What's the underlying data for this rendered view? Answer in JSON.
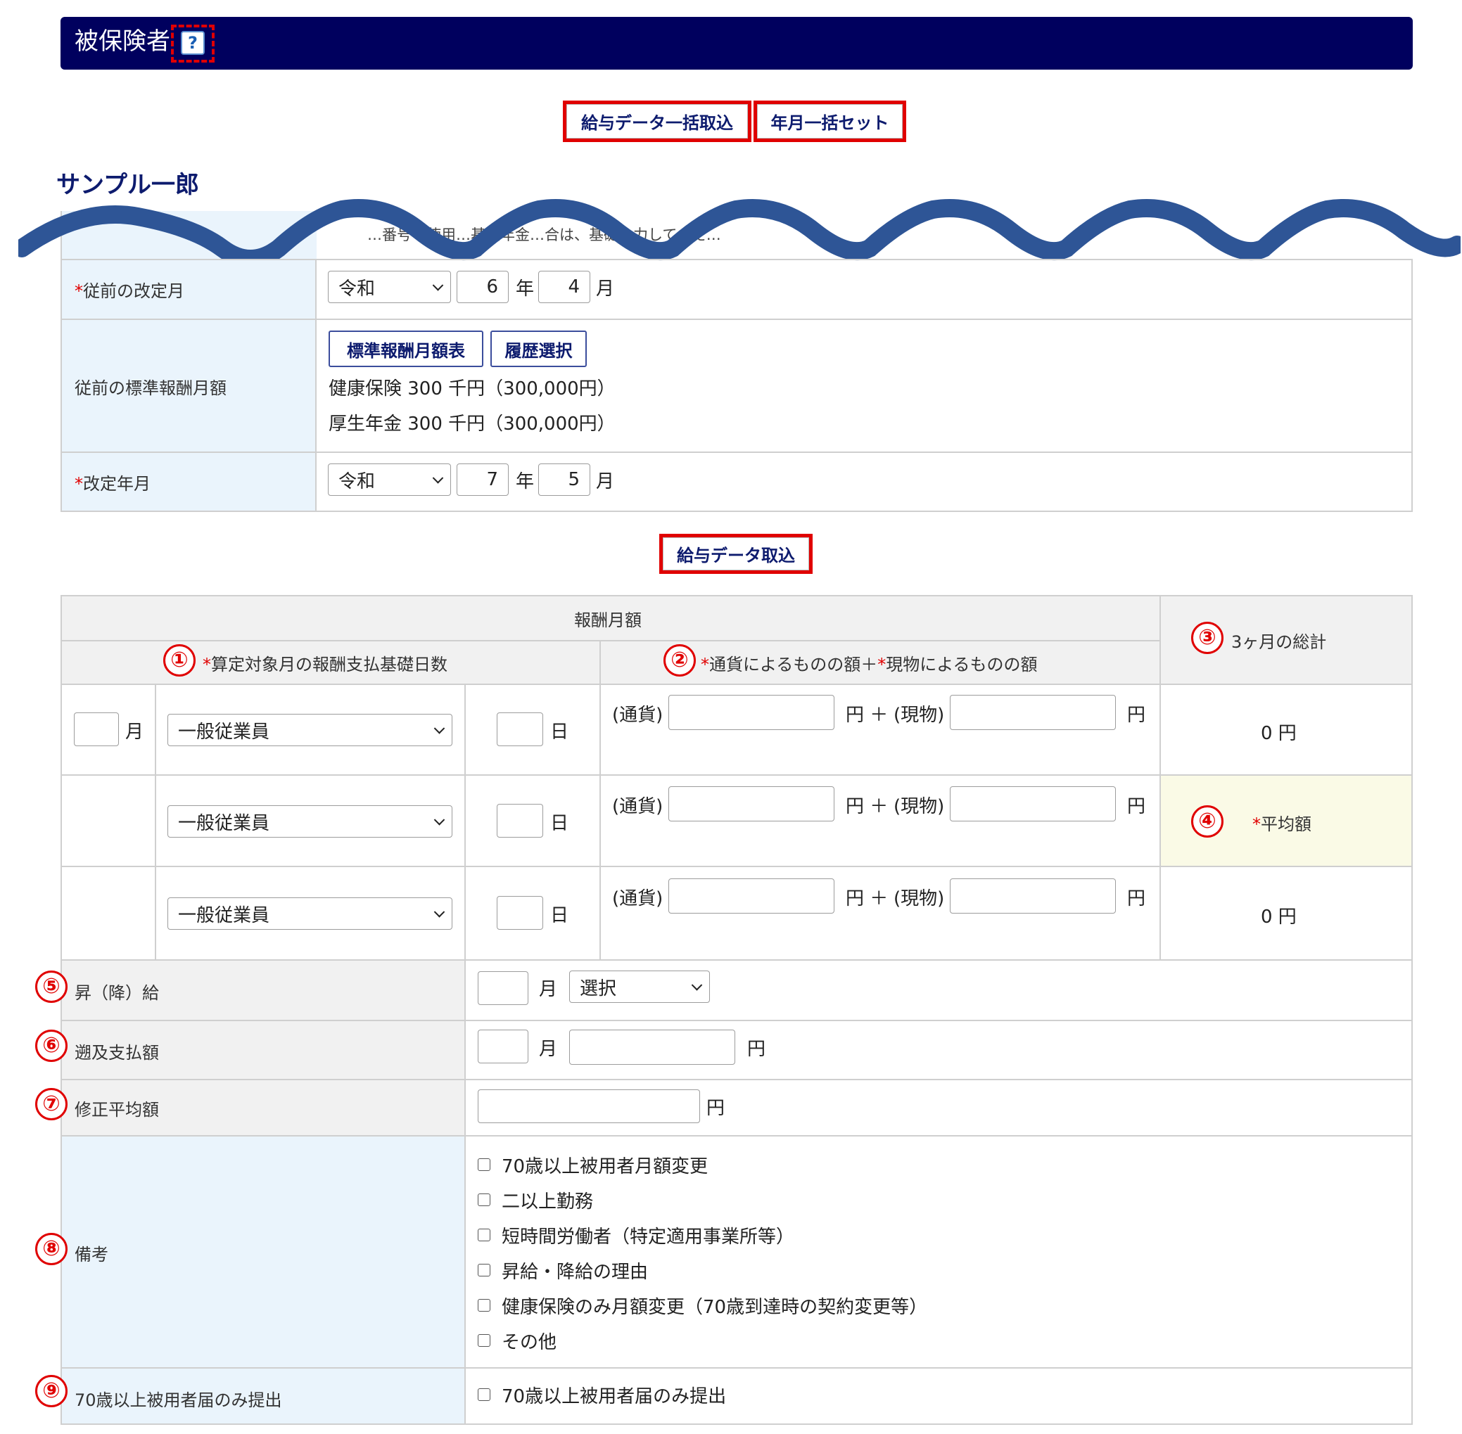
{
  "header": {
    "title": "被保険者",
    "help": "?"
  },
  "toolbar": {
    "bulk_import": "給与データ一括取込",
    "bulk_set": "年月一括セット"
  },
  "person": {
    "name": "サンプル一郎"
  },
  "obscured_note": "…番号を使用…基礎年金…合は、基礎…力してくだ…",
  "prev_revision": {
    "label": "従前の改定月",
    "era": "令和",
    "year": "6",
    "year_unit": "年",
    "month": "4",
    "month_unit": "月"
  },
  "prev_standard": {
    "label": "従前の標準報酬月額",
    "table_button": "標準報酬月額表",
    "history_button": "履歴選択",
    "health": "健康保険 300 千円（300,000円）",
    "pension": "厚生年金 300 千円（300,000円）"
  },
  "revision": {
    "label": "改定年月",
    "era": "令和",
    "year": "7",
    "year_unit": "年",
    "month": "5",
    "month_unit": "月"
  },
  "salary_import": "給与データ取込",
  "pay_table": {
    "header": "報酬月額",
    "col1": "算定対象月の報酬支払基礎日数",
    "col2_a": "通貨によるものの額＋",
    "col2_b": "現物によるものの額",
    "col3": "3ヶ月の総計",
    "month_unit": "月",
    "day_unit": "日",
    "currency_label": "(通貨)",
    "kind_label": "(現物)",
    "yen_plus": "円 ＋",
    "yen": "円",
    "employee_type": "一般従業員",
    "total": "0 円",
    "average_label": "平均額",
    "row3_total": "0 円"
  },
  "raise": {
    "label": "昇（降）給",
    "month_unit": "月",
    "select": "選択"
  },
  "retro": {
    "label": "遡及支払額",
    "month_unit": "月",
    "yen": "円"
  },
  "corrected": {
    "label": "修正平均額",
    "yen": "円"
  },
  "remarks": {
    "label": "備考",
    "items": [
      "70歳以上被用者月額変更",
      "二以上勤務",
      "短時間労働者（特定適用事業所等）",
      "昇給・降給の理由",
      "健康保険のみ月額変更（70歳到達時の契約変更等）",
      "その他"
    ]
  },
  "over70": {
    "label": "70歳以上被用者届のみ提出",
    "item": "70歳以上被用者届のみ提出"
  },
  "markers": [
    "①",
    "②",
    "③",
    "④",
    "⑤",
    "⑥",
    "⑦",
    "⑧",
    "⑨"
  ],
  "colors": {
    "header_bg": "#00005e",
    "highlight": "#e00000",
    "label_bg": "#eaf4fc",
    "average_bg": "#fafae6",
    "wave": "#2e5596"
  }
}
